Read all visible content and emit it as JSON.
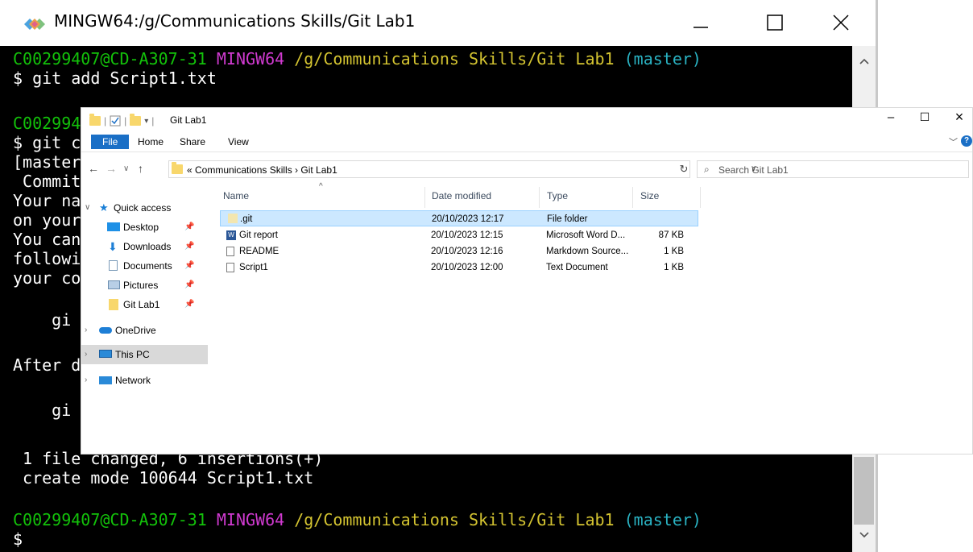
{
  "terminal": {
    "title": "MINGW64:/g/Communications Skills/Git Lab1",
    "prompt_user": "C00299407@CD-A307-31",
    "prompt_shell": "MINGW64",
    "prompt_path": "/g/Communications Skills/Git Lab1",
    "prompt_branch": "(master)",
    "cmd1": "$ git add Script1.txt",
    "partial_prompt2": "C002994",
    "partial_cmd2": "$ git c",
    "partial_line_master": "[master",
    "partial_commit": " Commit",
    "partial_your_name": "Your na",
    "partial_on_your": "on your",
    "partial_you_can": "You can",
    "partial_followi": "followi",
    "partial_your_co": "your co",
    "partial_gi1": "    gi",
    "partial_after": "After d",
    "partial_gi2": "    gi",
    "line_files_changed": " 1 file changed, 6 insertions(+)",
    "line_create_mode": " create mode 100644 Script1.txt",
    "prompt_end": "$",
    "colors": {
      "user": "#13c20a",
      "shell": "#d03ad0",
      "path": "#d4c431",
      "branch": "#2ab3c3"
    }
  },
  "explorer": {
    "title": "Git Lab1",
    "ribbon": {
      "file": "File",
      "home": "Home",
      "share": "Share",
      "view": "View"
    },
    "address": "« Communications Skills › Git Lab1",
    "search_placeholder": "Search Git Lab1",
    "nav": {
      "quick_access": "Quick access",
      "desktop": "Desktop",
      "downloads": "Downloads",
      "documents": "Documents",
      "pictures": "Pictures",
      "git_lab1": "Git Lab1",
      "onedrive": "OneDrive",
      "this_pc": "This PC",
      "network": "Network"
    },
    "columns": {
      "name": "Name",
      "date": "Date modified",
      "type": "Type",
      "size": "Size"
    },
    "files": [
      {
        "name": ".git",
        "date": "20/10/2023 12:17",
        "type": "File folder",
        "size": ""
      },
      {
        "name": "Git report",
        "date": "20/10/2023 12:15",
        "type": "Microsoft Word D...",
        "size": "87 KB"
      },
      {
        "name": "README",
        "date": "20/10/2023 12:16",
        "type": "Markdown Source...",
        "size": "1 KB"
      },
      {
        "name": "Script1",
        "date": "20/10/2023 12:00",
        "type": "Text Document",
        "size": "1 KB"
      }
    ]
  }
}
